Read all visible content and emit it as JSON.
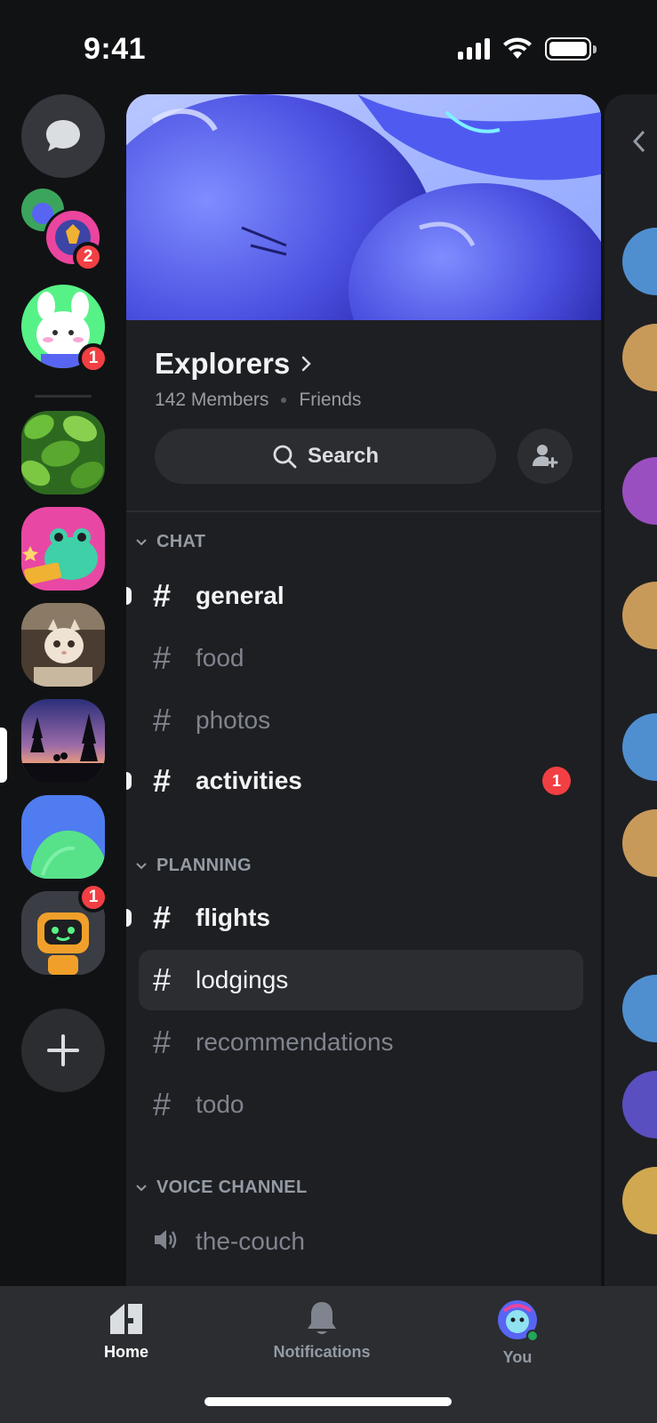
{
  "status_bar": {
    "time": "9:41",
    "battery_level": 1.0
  },
  "rail": {
    "dm_icon": "chat-bubble-icon",
    "servers": [
      {
        "name": "group-dm",
        "badge": "2"
      },
      {
        "name": "bunny-server",
        "badge": "1"
      },
      {
        "name": "leaf-server",
        "badge": ""
      },
      {
        "name": "frog-server",
        "badge": ""
      },
      {
        "name": "kitten-server",
        "badge": ""
      },
      {
        "name": "sunset-server",
        "badge": ""
      },
      {
        "name": "blob-server",
        "badge": ""
      },
      {
        "name": "robot-server",
        "badge": "1"
      }
    ],
    "add_icon": "plus-icon"
  },
  "server": {
    "name": "Explorers",
    "members": "142 Members",
    "tag": "Friends",
    "search_label": "Search"
  },
  "categories": {
    "chat": {
      "label": "CHAT",
      "channels": [
        {
          "name": "general",
          "unread": true,
          "badge": ""
        },
        {
          "name": "food",
          "unread": false,
          "badge": ""
        },
        {
          "name": "photos",
          "unread": false,
          "badge": ""
        },
        {
          "name": "activities",
          "unread": true,
          "badge": "1"
        }
      ]
    },
    "planning": {
      "label": "PLANNING",
      "channels": [
        {
          "name": "flights",
          "unread": true
        },
        {
          "name": "lodgings",
          "selected": true
        },
        {
          "name": "recommendations"
        },
        {
          "name": "todo"
        }
      ]
    },
    "voice": {
      "label": "VOICE CHANNEL",
      "channels": [
        {
          "name": "the-couch",
          "icon": "speaker-icon"
        }
      ]
    }
  },
  "nav": {
    "home": "Home",
    "notifications": "Notifications",
    "you": "You"
  },
  "colors": {
    "background": "#111214",
    "panel": "#1e1f22",
    "accent_red": "#f23f43",
    "online_green": "#23a55a"
  }
}
